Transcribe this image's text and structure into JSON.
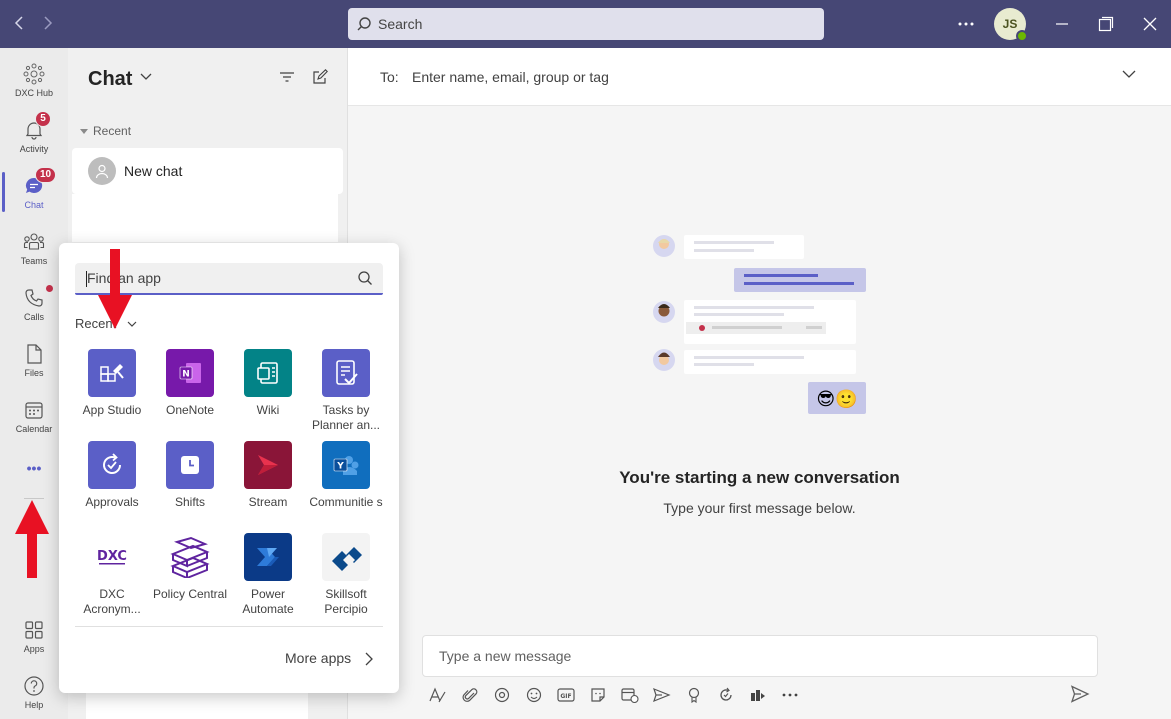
{
  "titlebar": {
    "search_placeholder": "Search",
    "avatar_initials": "JS",
    "status_color": "#6bb700",
    "bg_color": "#464775"
  },
  "rail": {
    "items": [
      {
        "label": "DXC Hub",
        "icon": "dxc-hub-icon"
      },
      {
        "label": "Activity",
        "icon": "bell-icon",
        "badge": "5"
      },
      {
        "label": "Chat",
        "icon": "chat-icon",
        "badge": "10",
        "active": true
      },
      {
        "label": "Teams",
        "icon": "teams-icon"
      },
      {
        "label": "Calls",
        "icon": "phone-icon"
      },
      {
        "label": "Files",
        "icon": "file-icon"
      },
      {
        "label": "Calendar",
        "icon": "calendar-icon"
      },
      {
        "label": "",
        "icon": "more-icon"
      },
      {
        "label": "Apps",
        "icon": "apps-icon"
      },
      {
        "label": "Help",
        "icon": "help-icon"
      }
    ],
    "more_glyph": "•••"
  },
  "chatlist": {
    "title": "Chat",
    "recent_label": "Recent",
    "new_chat_label": "New chat"
  },
  "main": {
    "to_label": "To:",
    "to_placeholder": "Enter name, email, group or tag",
    "conversation_title": "You're starting a new conversation",
    "conversation_subtitle": "Type your first message below.",
    "compose_placeholder": "Type a new message",
    "emoji_glyphs": "😎🙂"
  },
  "app_popup": {
    "search_placeholder": "Find an app",
    "recent_label": "Recent",
    "more_apps_label": "More apps",
    "apps": [
      {
        "name": "App Studio",
        "color": "#5b5fc7",
        "icon": "app-studio-icon"
      },
      {
        "name": "OneNote",
        "color": "#7719aa",
        "icon": "onenote-icon"
      },
      {
        "name": "Wiki",
        "color": "#038387",
        "icon": "wiki-icon"
      },
      {
        "name": "Tasks by Planner an...",
        "color": "#5b5fc7",
        "icon": "tasks-icon"
      },
      {
        "name": "Approvals",
        "color": "#5b5fc7",
        "icon": "approvals-icon"
      },
      {
        "name": "Shifts",
        "color": "#5b5fc7",
        "icon": "shifts-icon"
      },
      {
        "name": "Stream",
        "color": "#8a1538",
        "icon": "stream-icon"
      },
      {
        "name": "Communitie s",
        "color": "#106ebe",
        "icon": "communities-icon"
      },
      {
        "name": "DXC Acronym...",
        "color": "#ffffff",
        "icon": "dxc-icon"
      },
      {
        "name": "Policy Central",
        "color": "#ffffff",
        "icon": "policy-central-icon"
      },
      {
        "name": "Power Automate",
        "color": "#0b3a87",
        "icon": "power-automate-icon"
      },
      {
        "name": "Skillsoft Percipio",
        "color": "#f3f3f3",
        "icon": "skillsoft-icon"
      }
    ]
  },
  "annotations": {
    "arrow_color": "#e81123"
  }
}
